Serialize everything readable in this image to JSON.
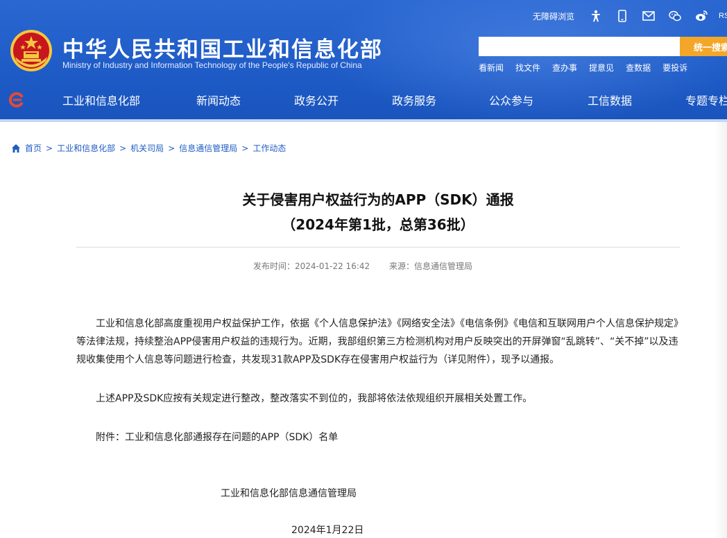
{
  "header": {
    "title": "中华人民共和国工业和信息化部",
    "subtitle": "Ministry of Industry and Information Technology of the People's Republic of China",
    "accessible": "无障碍浏览",
    "rss": "RSS",
    "search_placeholder": "",
    "search_button": "统一搜索",
    "quick_links": [
      "看新闻",
      "找文件",
      "查办事",
      "提意见",
      "查数据",
      "要投诉"
    ],
    "nav": [
      "工业和信息化部",
      "新闻动态",
      "政务公开",
      "政务服务",
      "公众参与",
      "工信数据",
      "专题专栏"
    ]
  },
  "breadcrumb": [
    "首页",
    "工业和信息化部",
    "机关司局",
    "信息通信管理局",
    "工作动态"
  ],
  "article": {
    "title_line1": "关于侵害用户权益行为的APP（SDK）通报",
    "title_line2": "（2024年第1批，总第36批）",
    "publish_time": "发布时间：2024-01-22 16:42",
    "source": "来源：信息通信管理局",
    "paragraph1": "工业和信息化部高度重视用户权益保护工作，依据《个人信息保护法》《网络安全法》《电信条例》《电信和互联网用户个人信息保护规定》等法律法规，持续整治APP侵害用户权益的违规行为。近期，我部组织第三方检测机构对用户反映突出的开屏弹窗“乱跳转”、“关不掉”以及违规收集使用个人信息等问题进行检查，共发现31款APP及SDK存在侵害用户权益行为（详见附件），现予以通报。",
    "paragraph2": "上述APP及SDK应按有关规定进行整改，整改落实不到位的，我部将依法依规组织开展相关处置工作。",
    "attachment": "附件：工业和信息化部通报存在问题的APP（SDK）名单",
    "signature": "工业和信息化部信息通信管理局",
    "date": "2024年1月22日"
  },
  "colors": {
    "header_blue": "#1e5bc6",
    "search_orange": "#f4a629",
    "link_blue": "#1f5cc4",
    "emblem_red": "#c8161d",
    "emblem_gold": "#f3c643"
  },
  "icons": [
    "national-emblem-icon",
    "accessibility-icon",
    "mobile-icon",
    "mail-icon",
    "wechat-icon",
    "weibo-icon",
    "home-icon",
    "e-logo-icon"
  ]
}
